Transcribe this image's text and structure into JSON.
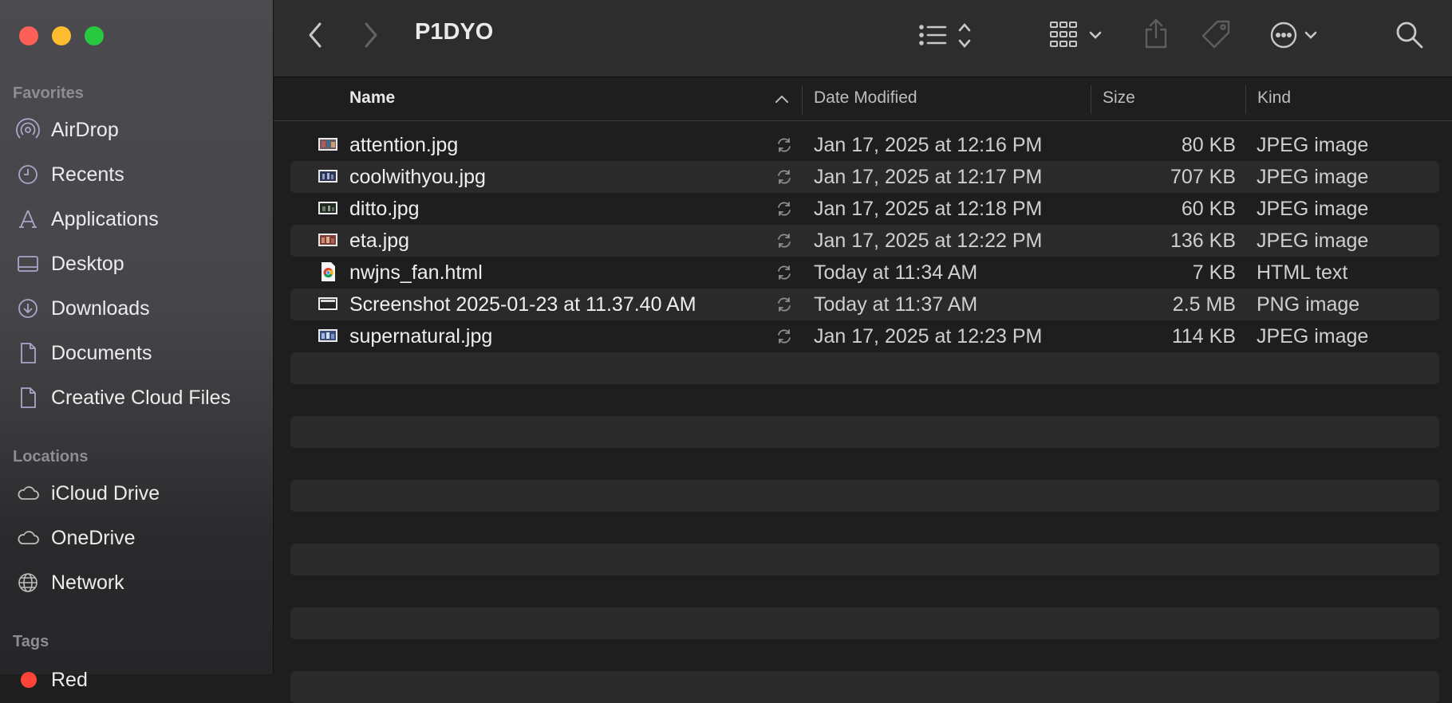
{
  "window": {
    "title": "P1DYO"
  },
  "sidebar": {
    "favorites_title": "Favorites",
    "favorites": [
      {
        "label": "AirDrop",
        "icon": "airdrop-icon"
      },
      {
        "label": "Recents",
        "icon": "clock-icon"
      },
      {
        "label": "Applications",
        "icon": "applications-icon"
      },
      {
        "label": "Desktop",
        "icon": "desktop-icon"
      },
      {
        "label": "Downloads",
        "icon": "download-icon"
      },
      {
        "label": "Documents",
        "icon": "document-icon"
      },
      {
        "label": "Creative Cloud Files",
        "icon": "document-icon"
      }
    ],
    "locations_title": "Locations",
    "locations": [
      {
        "label": "iCloud Drive",
        "icon": "cloud-icon"
      },
      {
        "label": "OneDrive",
        "icon": "cloud-icon"
      },
      {
        "label": "Network",
        "icon": "globe-icon"
      }
    ],
    "tags_title": "Tags",
    "tags": [
      {
        "label": "Red",
        "color": "#ff453a"
      }
    ]
  },
  "columns": {
    "name": "Name",
    "date": "Date Modified",
    "size": "Size",
    "kind": "Kind"
  },
  "files": [
    {
      "name": "attention.jpg",
      "date": "Jan 17, 2025 at 12:16 PM",
      "size": "80 KB",
      "kind": "JPEG image",
      "icon": "image-thumbnail-icon"
    },
    {
      "name": "coolwithyou.jpg",
      "date": "Jan 17, 2025 at 12:17 PM",
      "size": "707 KB",
      "kind": "JPEG image",
      "icon": "image-thumbnail-icon"
    },
    {
      "name": "ditto.jpg",
      "date": "Jan 17, 2025 at 12:18 PM",
      "size": "60 KB",
      "kind": "JPEG image",
      "icon": "image-thumbnail-icon"
    },
    {
      "name": "eta.jpg",
      "date": "Jan 17, 2025 at 12:22 PM",
      "size": "136 KB",
      "kind": "JPEG image",
      "icon": "image-thumbnail-icon"
    },
    {
      "name": "nwjns_fan.html",
      "date": "Today at 11:34 AM",
      "size": "7 KB",
      "kind": "HTML text",
      "icon": "chrome-document-icon"
    },
    {
      "name": "Screenshot 2025-01-23 at 11.37.40 AM",
      "date": "Today at 11:37 AM",
      "size": "2.5 MB",
      "kind": "PNG image",
      "icon": "screenshot-thumbnail-icon"
    },
    {
      "name": "supernatural.jpg",
      "date": "Jan 17, 2025 at 12:23 PM",
      "size": "114 KB",
      "kind": "JPEG image",
      "icon": "image-thumbnail-icon"
    }
  ],
  "colors": {
    "sidebar_bg": "#4b4a4f",
    "content_bg": "#1e1e1e",
    "alt_row": "#2a2a2a",
    "tag_red": "#ff453a"
  }
}
